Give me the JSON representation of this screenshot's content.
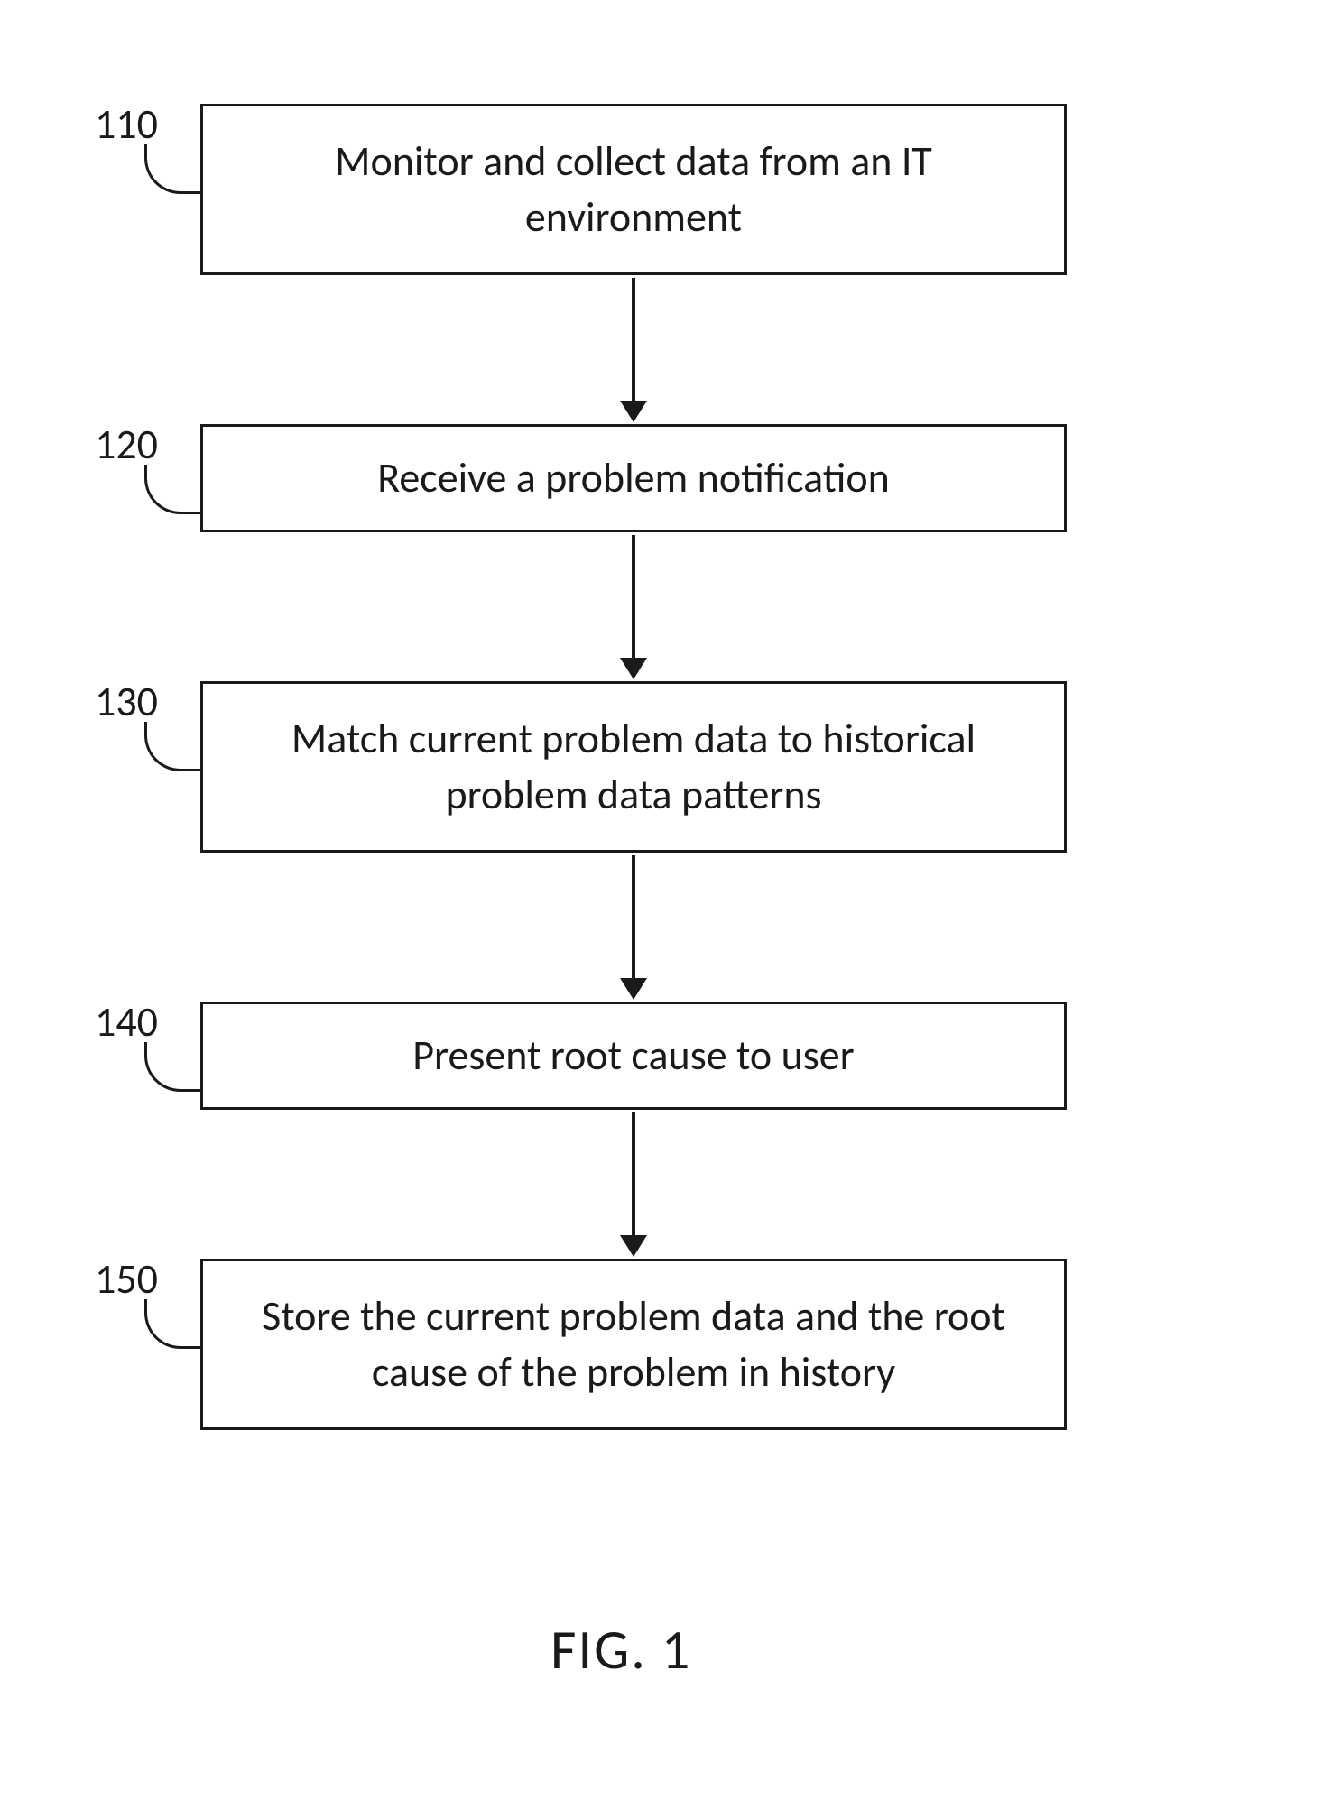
{
  "figure": {
    "caption": "FIG. 1"
  },
  "steps": [
    {
      "num": "110",
      "text": "Monitor and collect data from an IT environment"
    },
    {
      "num": "120",
      "text": "Receive a problem notification"
    },
    {
      "num": "130",
      "text": "Match current problem data to historical problem data patterns"
    },
    {
      "num": "140",
      "text": "Present root cause to user"
    },
    {
      "num": "150",
      "text": "Store the current problem data and the root cause of the problem in history"
    }
  ]
}
